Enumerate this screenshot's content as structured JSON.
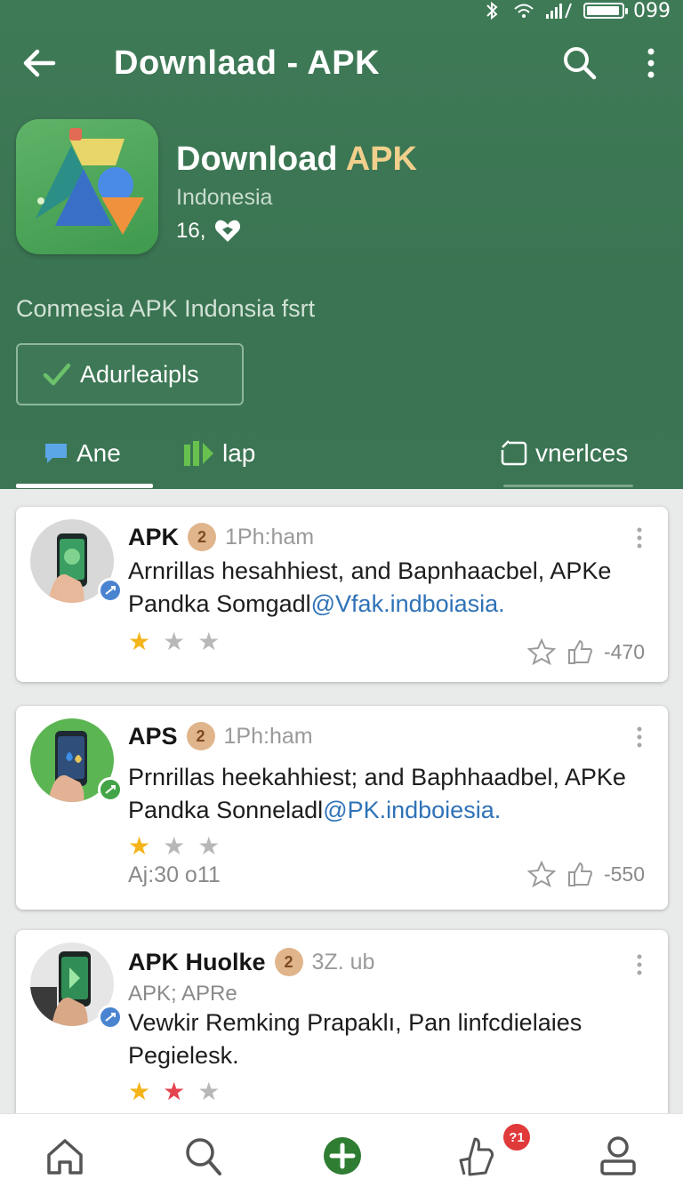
{
  "status_bar": {
    "time": "099",
    "icons": [
      "bluetooth-icon",
      "wifi-icon",
      "signal-icon",
      "battery-icon"
    ]
  },
  "app_bar": {
    "title": "Downlaad - APK",
    "icons": [
      "back-arrow-icon",
      "search-icon",
      "more-vert-icon"
    ]
  },
  "app": {
    "name_main": "Download ",
    "name_accent": "APK",
    "country": "Indonesia",
    "count": "16,",
    "tagline": "Conmesia APK Indonsia fsrt",
    "install_label": "Adurleaipls",
    "accent_color": "#f0d08c"
  },
  "tabs": [
    {
      "label": "Ane",
      "icon": "chat-icon",
      "active": true
    },
    {
      "label": "lap",
      "icon": "chart-icon",
      "active": false
    },
    {
      "label": "vnerlces",
      "icon": "edit-icon",
      "active": false
    }
  ],
  "posts": [
    {
      "name": "APK",
      "medal": "2",
      "time": "1Ph:ham",
      "text_plain": "Arnrillas hesahhiest, and Bapnhaacbel, APKe Pandka Somgadl",
      "text_link": "@Vfak.indboiasia.",
      "stars": [
        "gold",
        "grey",
        "grey"
      ],
      "meta": "",
      "count": "-470"
    },
    {
      "name": "APS",
      "medal": "2",
      "time": "1Ph:ham",
      "text_plain": "Prnrillas heekahhiest; and Baphhaadbel, APKe Pandka Sonneladl",
      "text_link": "@PK.indboiesia.",
      "stars": [
        "gold",
        "grey",
        "grey"
      ],
      "meta": "Aj:30 o11",
      "count": "-550"
    },
    {
      "name": "APK Huolke",
      "medal": "2",
      "time": "3Z. ub",
      "sub": "APK; APRe",
      "text_plain": "Vewkir Remking Prapaklı, Pan linfcdielaies Pegielesk.",
      "text_link": "",
      "stars": [
        "gold",
        "red",
        "grey"
      ],
      "meta": "",
      "count": ""
    }
  ],
  "bottom_nav": {
    "items": [
      "home-icon",
      "search-icon",
      "add-icon",
      "like-icon",
      "profile-icon"
    ],
    "badge": "?1",
    "add_color": "#2e7d32"
  }
}
